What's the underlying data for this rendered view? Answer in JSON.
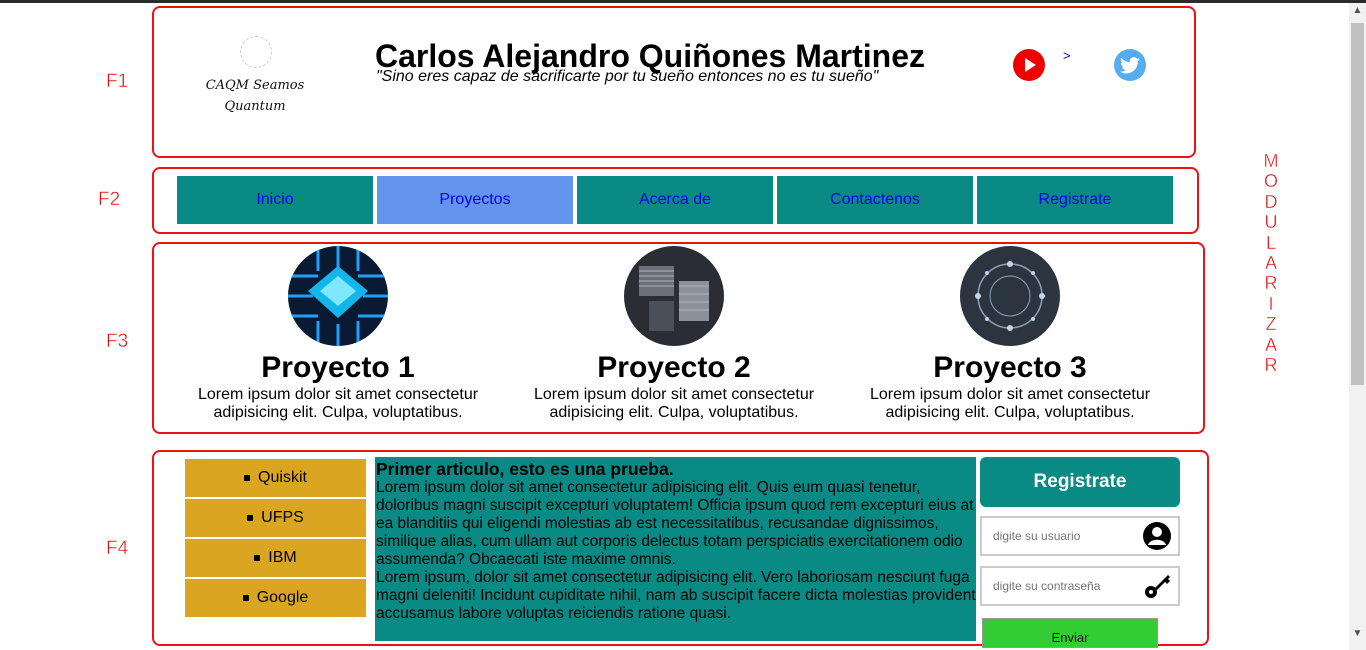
{
  "labels": {
    "f1": "F1",
    "f2": "F2",
    "f3": "F3",
    "f4": "F4"
  },
  "header": {
    "logo_text": "CAQM Seamos Quantum",
    "title": "Carlos Alejandro Quiñones Martinez",
    "quote": "\"Sino eres capaz de sacrificarte por tu sueño entonces no es tu sueño\"",
    "arrow_link": ">"
  },
  "nav": {
    "items": [
      {
        "label": "Inicio",
        "active": false
      },
      {
        "label": "Proyectos",
        "active": true
      },
      {
        "label": "Acerca de",
        "active": false
      },
      {
        "label": "Contactenos",
        "active": false
      },
      {
        "label": "Registrate",
        "active": false
      }
    ]
  },
  "side_vertical": [
    "M",
    "O",
    "D",
    "U",
    "L",
    "A",
    "R",
    "I",
    "Z",
    "A",
    "R"
  ],
  "projects": [
    {
      "title": "Proyecto 1",
      "desc_line1": "Lorem ipsum dolor sit amet consectetur",
      "desc_line2": "adipisicing elit. Culpa, voluptatibus."
    },
    {
      "title": "Proyecto 2",
      "desc_line1": "Lorem ipsum dolor sit amet consectetur",
      "desc_line2": "adipisicing elit. Culpa, voluptatibus."
    },
    {
      "title": "Proyecto 3",
      "desc_line1": "Lorem ipsum dolor sit amet consectetur",
      "desc_line2": "adipisicing elit. Culpa, voluptatibus."
    }
  ],
  "menu": [
    "Quiskit",
    "UFPS",
    "IBM",
    "Google"
  ],
  "article": {
    "title": "Primer articulo, esto es una prueba.",
    "para1": "Lorem ipsum dolor sit amet consectetur adipisicing elit. Quis eum quasi tenetur, doloribus magni suscipit excepturi voluptatem! Officia ipsum quod rem excepturi eius at ea blanditiis qui eligendi molestias ab est necessitatibus, recusandae dignissimos, similique alias, cum ullam aut corporis delectus totam perspiciatis exercitationem odio assumenda? Obcaecati iste maxime omnis.",
    "para2": "Lorem ipsum, dolor sit amet consectetur adipisicing elit. Vero laboriosam nesciunt fuga magni deleniti! Incidunt cupiditate nihil, nam ab suscipit facere dicta molestias provident accusamus labore voluptas reiciendis ratione quasi."
  },
  "register": {
    "header": "Registrate",
    "user_placeholder": "digite su usuario",
    "pass_placeholder": "digite su contraseña",
    "send_label": "Enviar"
  },
  "colors": {
    "teal": "#0a8a84",
    "active_nav": "#6495ed",
    "gold": "#daa520",
    "frame_red": "#ee1111",
    "send_green": "#33cc33"
  }
}
